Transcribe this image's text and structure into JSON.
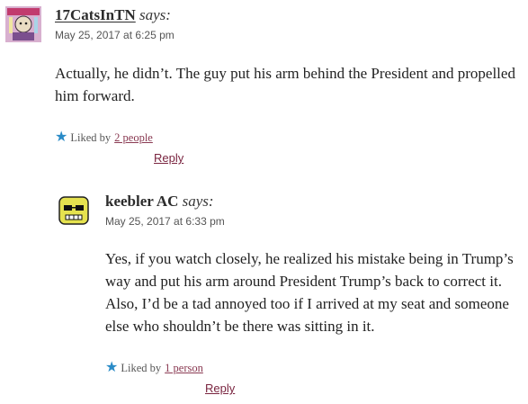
{
  "comments": [
    {
      "author": "17CatsInTN",
      "says": "says:",
      "date": "May 25, 2017 at 6:25 pm",
      "text": "Actually, he didn’t. The guy put his arm behind the President and propelled him forward.",
      "liked_by_prefix": "Liked by",
      "liked_by_link": "2 people",
      "reply": "Reply"
    },
    {
      "author": "keebler AC",
      "says": "says:",
      "date": "May 25, 2017 at 6:33 pm",
      "text": "Yes, if you watch closely, he realized his mistake being in Trump’s way and put his arm around President Trump’s back to correct it. Also, I’d be a tad annoyed too if I arrived at my seat and someone else who shouldn’t be there was sitting in it.",
      "liked_by_prefix": "Liked by",
      "liked_by_link": "1 person",
      "reply": "Reply"
    }
  ],
  "icons": {
    "like_star": "star-icon",
    "star_color": "#2a8bc7",
    "link_color": "#8a3a52"
  }
}
